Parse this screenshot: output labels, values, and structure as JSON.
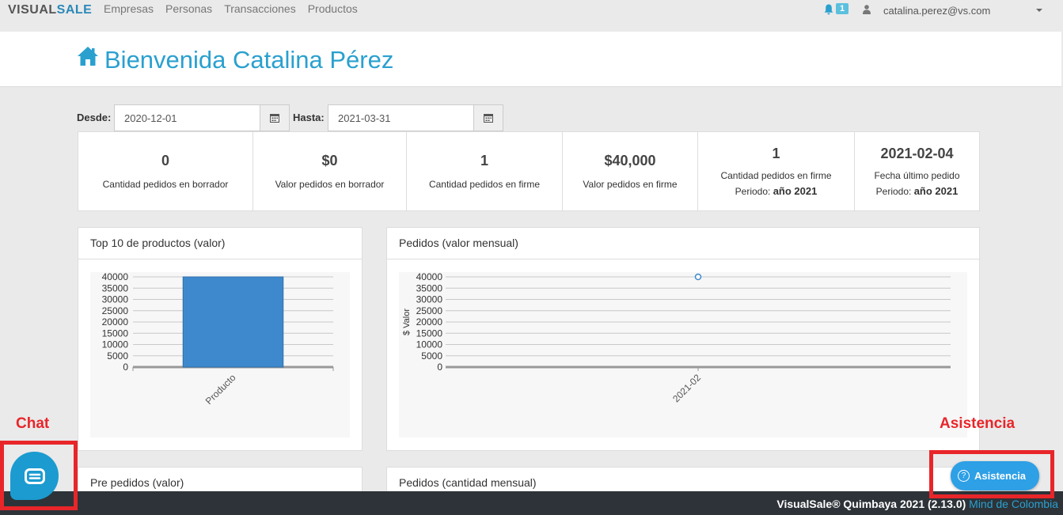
{
  "nav": {
    "logo_v": "V",
    "logo_rest": "ISUAL",
    "logo_sale": "SALE",
    "links": [
      "Empresas",
      "Personas",
      "Transacciones",
      "Productos"
    ],
    "notifications_count": "1",
    "user_email": "catalina.perez@vs.com"
  },
  "header": {
    "title": "Bienvenida Catalina Pérez"
  },
  "filters": {
    "from_label": "Desde:",
    "from_value": "2020-12-01",
    "to_label": "Hasta:",
    "to_value": "2021-03-31"
  },
  "stats": [
    {
      "value": "0",
      "caption": "Cantidad pedidos en borrador"
    },
    {
      "value": "$0",
      "caption": "Valor pedidos en borrador"
    },
    {
      "value": "1",
      "caption": "Cantidad pedidos en firme"
    },
    {
      "value": "$40,000",
      "caption": "Valor pedidos en firme"
    },
    {
      "value": "1",
      "caption": "Cantidad pedidos en firme",
      "period_label": "Periodo:",
      "period_value": "año 2021"
    },
    {
      "value": "2021-02-04",
      "caption": "Fecha último pedido",
      "period_label": "Periodo:",
      "period_value": "año 2021"
    }
  ],
  "panels": {
    "top10_title": "Top 10 de productos (valor)",
    "monthly_value_title": "Pedidos (valor mensual)",
    "prepedidos_title": "Pre pedidos (valor)",
    "monthly_qty_title": "Pedidos (cantidad mensual)"
  },
  "chart_data": [
    {
      "type": "bar",
      "categories": [
        "Producto"
      ],
      "values": [
        40000
      ],
      "ylim": [
        0,
        40000
      ],
      "yticks": [
        0,
        5000,
        10000,
        15000,
        20000,
        25000,
        30000,
        35000,
        40000
      ],
      "grid": true,
      "color": "#3e89ce"
    },
    {
      "type": "line",
      "x": [
        "2021-02"
      ],
      "y": [
        40000
      ],
      "ylabel": "$ Valor",
      "ylim": [
        0,
        40000
      ],
      "yticks": [
        0,
        5000,
        10000,
        15000,
        20000,
        25000,
        30000,
        35000,
        40000
      ],
      "grid": true,
      "color": "#3e89ce"
    }
  ],
  "annotations": {
    "chat_label": "Chat",
    "assist_label": "Asistencia"
  },
  "assist_button": {
    "label": "Asistencia",
    "icon_glyph": "?"
  },
  "footer": {
    "text": "VisualSale® Quimbaya 2021 (2.13.0)",
    "link": "Mind de Colombia"
  },
  "colors": {
    "accent": "#2aa0cf",
    "annotation": "#e8262a",
    "footer": "#2d3338"
  }
}
